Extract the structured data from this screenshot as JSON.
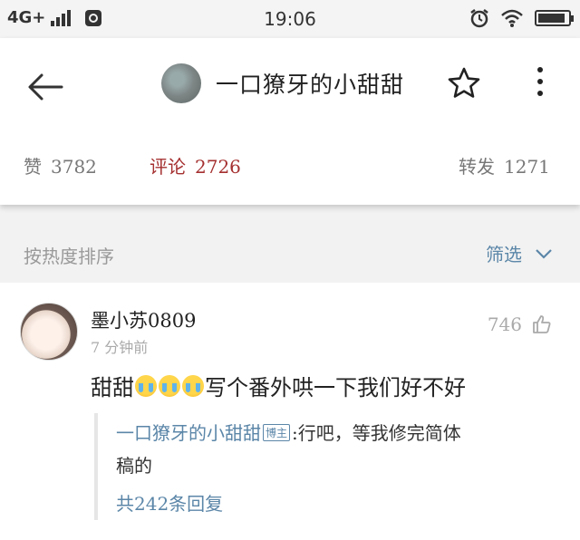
{
  "status_bar": {
    "network": "4G+",
    "time": "19:06",
    "battery_level_fraction": 0.9
  },
  "header": {
    "title": "一口獠牙的小甜甜",
    "stats": [
      {
        "label": "赞",
        "count": "3782",
        "active": false
      },
      {
        "label": "评论",
        "count": "2726",
        "active": true
      },
      {
        "label": "转发",
        "count": "1271",
        "active": false
      }
    ]
  },
  "sort_bar": {
    "sort_label": "按热度排序",
    "filter_label": "筛选"
  },
  "comment": {
    "user_name": "墨小苏0809",
    "time_ago": "7 分钟前",
    "likes": "746",
    "text_before": "甜甜",
    "emoji_count": 3,
    "text_after": "写个番外哄一下我们好不好",
    "reply": {
      "author": "一口獠牙的小甜甜",
      "badge": "博主",
      "text_line1": ":行吧，等我修完简体",
      "text_line2": "稿的",
      "reply_count_text": "共242条回复"
    }
  },
  "colors": {
    "accent_blue": "#5b86a8",
    "active_red": "#a53030"
  }
}
